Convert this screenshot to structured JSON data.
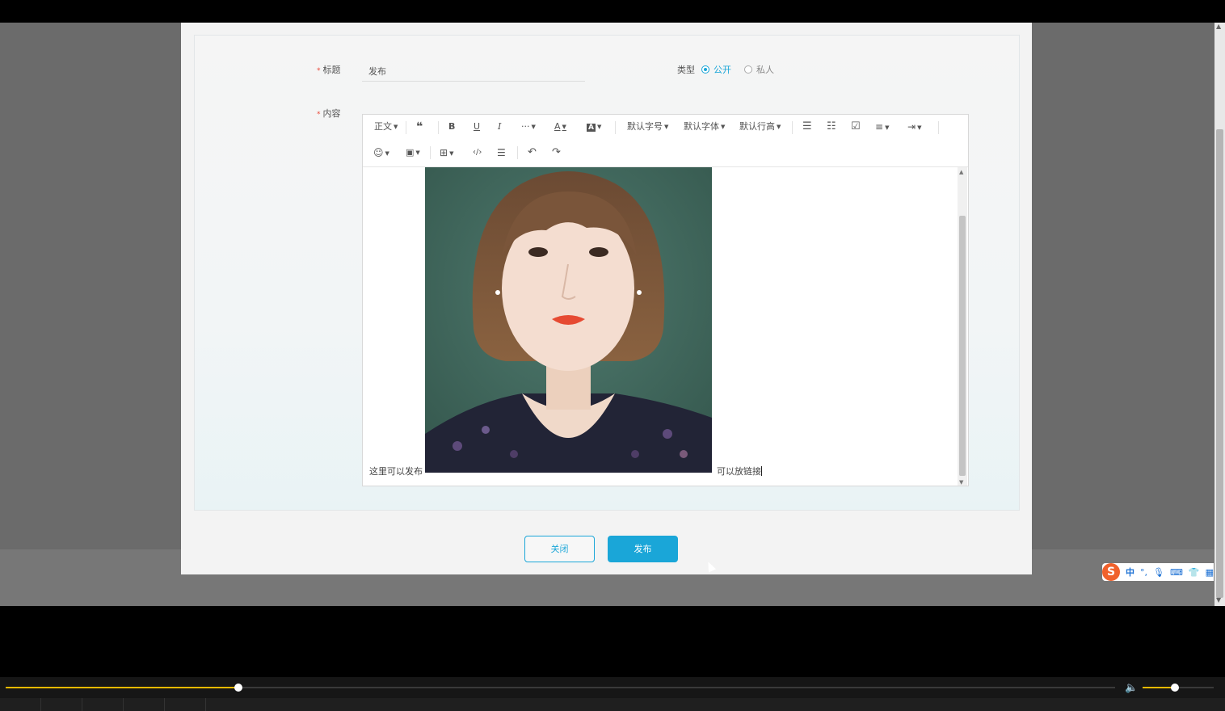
{
  "form": {
    "title_label": "标题",
    "required_mark": "*",
    "title_value": "发布",
    "type_label": "类型",
    "type_options": [
      {
        "label": "公开",
        "checked": true
      },
      {
        "label": "私人",
        "checked": false
      }
    ],
    "content_label": "内容"
  },
  "toolbar": {
    "paragraph": "正文",
    "font_size": "默认字号",
    "font_family": "默认字体",
    "line_height": "默认行高",
    "icons_row1": [
      "quote-icon",
      "bold-icon",
      "underline-icon",
      "italic-icon",
      "more-icon",
      "font-color-icon",
      "background-color-icon",
      "bullet-list-icon",
      "numbered-list-icon",
      "todo-icon",
      "align-icon",
      "indent-icon"
    ],
    "icons_row2": [
      "emoji-icon",
      "image-icon",
      "table-icon",
      "code-icon",
      "divider-icon",
      "undo-icon",
      "redo-icon"
    ]
  },
  "content": {
    "text_before": "这里可以发布",
    "text_after": "可以放链接"
  },
  "buttons": {
    "close": "关闭",
    "publish": "发布"
  },
  "ime": {
    "logo": "S",
    "mode": "中"
  },
  "player": {
    "progress_fraction": 0.21,
    "volume_fraction": 0.45
  },
  "colors": {
    "accent": "#1aa6d8",
    "required": "#e94b3c",
    "progress": "#e8b800"
  }
}
